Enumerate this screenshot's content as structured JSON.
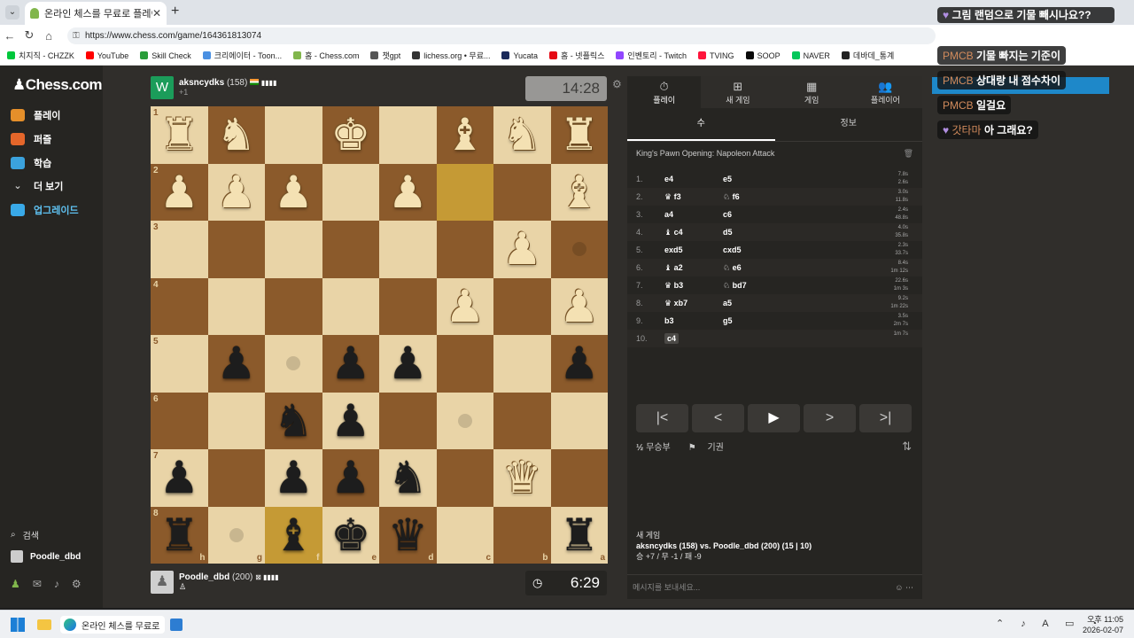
{
  "browser": {
    "tab_title": "온라인 체스를 무료로 플레이하세",
    "url": "https://www.chess.com/game/164361813074",
    "bookmarks": [
      "치지직 - CHZZK",
      "YouTube",
      "Skill Check",
      "크리에이터 - Toon...",
      "홈 - Chess.com",
      "챗gpt",
      "lichess.org • 무료...",
      "Yucata",
      "홈 - 넷플릭스",
      "인벤토리 - Twitch",
      "TVING",
      "SOOP",
      "NAVER",
      "데바데_통계"
    ],
    "bookmark_colors": [
      "#00c73c",
      "#ff0000",
      "#2a9d3a",
      "#4a90e2",
      "#81b64c",
      "#555555",
      "#333333",
      "#1a2a5a",
      "#e50914",
      "#9146ff",
      "#ff153c",
      "#0a0a0a",
      "#03c75a",
      "#222222"
    ]
  },
  "sidebar": {
    "logo": "Chess.com",
    "items": [
      {
        "label": "플레이",
        "icon": "pawn-icon",
        "color": "#e58f2a"
      },
      {
        "label": "퍼즐",
        "icon": "puzzle-icon",
        "color": "#e5662a"
      },
      {
        "label": "학습",
        "icon": "learn-icon",
        "color": "#3ba2dd"
      },
      {
        "label": "더 보기",
        "icon": "chevron-down-icon",
        "color": "#262522"
      },
      {
        "label": "업그레이드",
        "icon": "diamond-icon",
        "color": "#39a9e8"
      }
    ],
    "search": "검색",
    "user": "Poodle_dbd"
  },
  "top_player": {
    "avatar": "W",
    "name": "aksncydks",
    "rating": "(158)",
    "sub": "+1",
    "clock": "14:28"
  },
  "bottom_player": {
    "name": "Poodle_dbd",
    "rating": "(200)",
    "clock": "6:29"
  },
  "board": {
    "ranks": [
      "1",
      "2",
      "3",
      "4",
      "5",
      "6",
      "7",
      "8"
    ],
    "files": [
      "h",
      "g",
      "f",
      "e",
      "d",
      "c",
      "b",
      "a"
    ],
    "pieces": [
      [
        "wr",
        "wn",
        "",
        "wk",
        "",
        "wb",
        "wn",
        "wr"
      ],
      [
        "wp",
        "wp",
        "wp",
        "",
        "wp",
        "",
        "",
        "wb"
      ],
      [
        "",
        "",
        "",
        "",
        "",
        "",
        "wp",
        ""
      ],
      [
        "",
        "",
        "",
        "",
        "",
        "wp",
        "",
        "wp"
      ],
      [
        "",
        "bp",
        "",
        "bp",
        "bp",
        "",
        "",
        "bp"
      ],
      [
        "",
        "",
        "bn",
        "bp",
        "",
        "",
        "",
        ""
      ],
      [
        "bp",
        "",
        "bp",
        "bp",
        "bn",
        "",
        "wq",
        ""
      ],
      [
        "br",
        "",
        "bb",
        "bk",
        "bq",
        "",
        "",
        "br"
      ]
    ],
    "highlights": [
      "1-5",
      "7-2"
    ],
    "hints": [
      "2-7",
      "4-2",
      "4-4",
      "3-7",
      "5-5",
      "6-4",
      "7-4",
      "6-0",
      "7-1"
    ]
  },
  "panel": {
    "tabs": [
      {
        "label": "플레이",
        "icon": "stopwatch-icon"
      },
      {
        "label": "새 게임",
        "icon": "plus-icon"
      },
      {
        "label": "게임",
        "icon": "board-icon"
      },
      {
        "label": "플레이어",
        "icon": "players-icon"
      }
    ],
    "subtabs": [
      "수",
      "정보"
    ],
    "opening": "King's Pawn Opening: Napoleon Attack",
    "moves": [
      {
        "n": "1.",
        "w": "e4",
        "b": "e5",
        "t1": "7.8s",
        "t2": "2.6s"
      },
      {
        "n": "2.",
        "w": "♛ f3",
        "b": "♘ f6",
        "t1": "3.0s",
        "t2": "11.8s"
      },
      {
        "n": "3.",
        "w": "a4",
        "b": "c6",
        "t1": "2.4s",
        "t2": "48.8s"
      },
      {
        "n": "4.",
        "w": "♝ c4",
        "b": "d5",
        "t1": "4.0s",
        "t2": "35.8s"
      },
      {
        "n": "5.",
        "w": "exd5",
        "b": "cxd5",
        "t1": "2.3s",
        "t2": "33.7s"
      },
      {
        "n": "6.",
        "w": "♝ a2",
        "b": "♘ e6",
        "t1": "8.4s",
        "t2": "1m 12s"
      },
      {
        "n": "7.",
        "w": "♛ b3",
        "b": "♘ bd7",
        "t1": "22.6s",
        "t2": "1m 3s"
      },
      {
        "n": "8.",
        "w": "♛ xb7",
        "b": "a5",
        "t1": "9.2s",
        "t2": "1m 22s"
      },
      {
        "n": "9.",
        "w": "b3",
        "b": "g5",
        "t1": "3.5s",
        "t2": "2m 7s"
      },
      {
        "n": "10.",
        "w": "c4",
        "b": "",
        "t1": "1m 7s",
        "t2": ""
      }
    ],
    "draw": "무승부",
    "resign": "기권",
    "new_game_title": "새 게임",
    "new_game_line": "aksncydks (158) vs. Poodle_dbd (200) (15 | 10)",
    "record": "승 +7 / 무 -1 / 패 -9",
    "message_placeholder": "메시지를 보내세요..."
  },
  "chat": [
    {
      "user": "",
      "msg": "그림 랜덤으로 기물 빼시나요??",
      "vip": true
    },
    {
      "user": "PMCB",
      "msg": "기물 빠지는 기준이"
    },
    {
      "user": "PMCB",
      "msg": "상대랑 내 점수차이"
    },
    {
      "user": "PMCB",
      "msg": "일걸요"
    },
    {
      "user": "갓타마",
      "msg": "아 그래요?",
      "vip": true
    }
  ],
  "taskbar": {
    "app": "온라인 체스를 무료로 풀",
    "time": "오후 11:05",
    "date": "2026-02-07"
  }
}
